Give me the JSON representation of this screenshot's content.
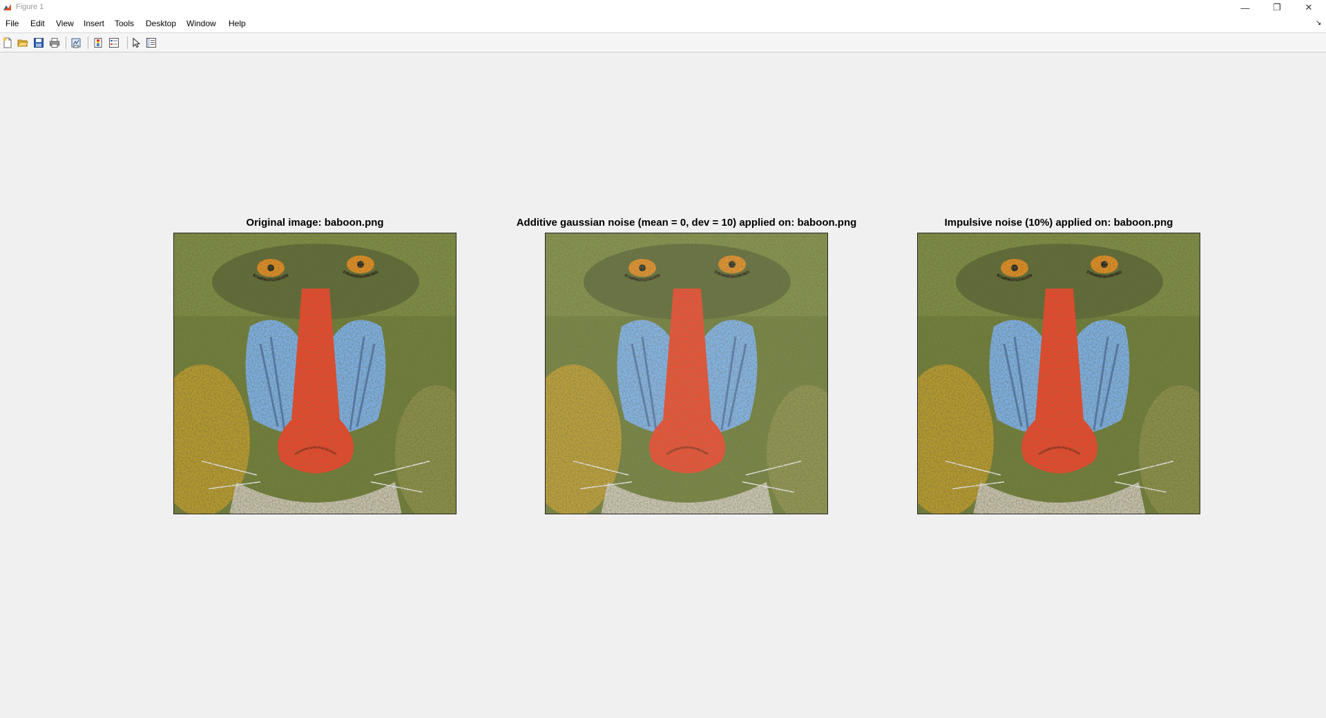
{
  "window": {
    "title": "Figure 1",
    "controls": [
      "—",
      "❐",
      "✕"
    ]
  },
  "menu": [
    "File",
    "Edit",
    "View",
    "Insert",
    "Tools",
    "Desktop",
    "Window",
    "Help"
  ],
  "toolbar": {
    "buttons": [
      "new-figure-icon",
      "open-file-icon",
      "save-icon",
      "print-icon",
      "link-plot-icon",
      "insert-colorbar-icon",
      "insert-legend-icon",
      "edit-plot-icon",
      "property-inspector-icon"
    ]
  },
  "plots": [
    {
      "title": "Original image: baboon.png",
      "noise": "none"
    },
    {
      "title": "Additive gaussian noise (mean = 0, dev = 10) applied on: baboon.png",
      "noise": "gaussian"
    },
    {
      "title": "Impulsive noise (10%) applied on: baboon.png",
      "noise": "impulsive"
    }
  ],
  "colors": {
    "fur_green": "#7a8a3a",
    "fur_yellow": "#c9a82a",
    "cheek_blue": "#7fb3e6",
    "nose_red": "#f0402a",
    "eye_orange": "#e08a1a"
  }
}
